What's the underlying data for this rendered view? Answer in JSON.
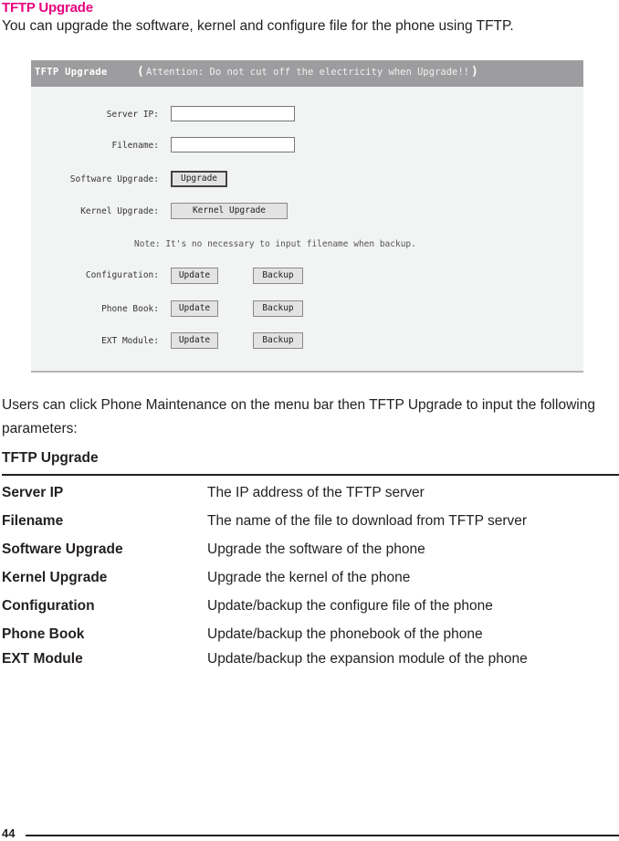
{
  "section_title": "TFTP Upgrade",
  "intro": "You can upgrade the software, kernel and configure file for the phone using TFTP.",
  "screenshot": {
    "header_title": "TFTP Upgrade",
    "open_paren": "(",
    "attention": "Attention: Do not cut off the electricity when Upgrade!!",
    "close_paren": ")",
    "server_ip_label": "Server IP:",
    "server_ip_value": "",
    "filename_label": "Filename:",
    "filename_value": "",
    "software_label": "Software Upgrade:",
    "software_button": "Upgrade",
    "kernel_label": "Kernel Upgrade:",
    "kernel_button": "Kernel Upgrade",
    "note": "Note: It's no necessary to input filename when backup.",
    "rows": [
      {
        "label": "Configuration:",
        "update": "Update",
        "backup": "Backup"
      },
      {
        "label": "Phone Book:",
        "update": "Update",
        "backup": "Backup"
      },
      {
        "label": "EXT Module:",
        "update": "Update",
        "backup": "Backup"
      }
    ]
  },
  "paragraph": "Users can click Phone Maintenance on the menu bar then TFTP Upgrade to input the following parameters:",
  "table": {
    "title": "TFTP Upgrade",
    "rows": [
      {
        "key": "Server IP",
        "value": "The IP address of the TFTP server"
      },
      {
        "key": "Filename",
        "value": "The name of the file to download from TFTP server"
      },
      {
        "key": "Software Upgrade",
        "value": "Upgrade the software of the phone"
      },
      {
        "key": "Kernel Upgrade",
        "value": "Upgrade the kernel of the phone"
      },
      {
        "key": "Configuration",
        "value": "Update/backup the configure file of the phone"
      },
      {
        "key": "Phone Book",
        "value": "Update/backup the phonebook of the phone"
      },
      {
        "key": "EXT Module",
        "value": "Update/backup the expansion module of the phone"
      }
    ]
  },
  "page_number": "44"
}
